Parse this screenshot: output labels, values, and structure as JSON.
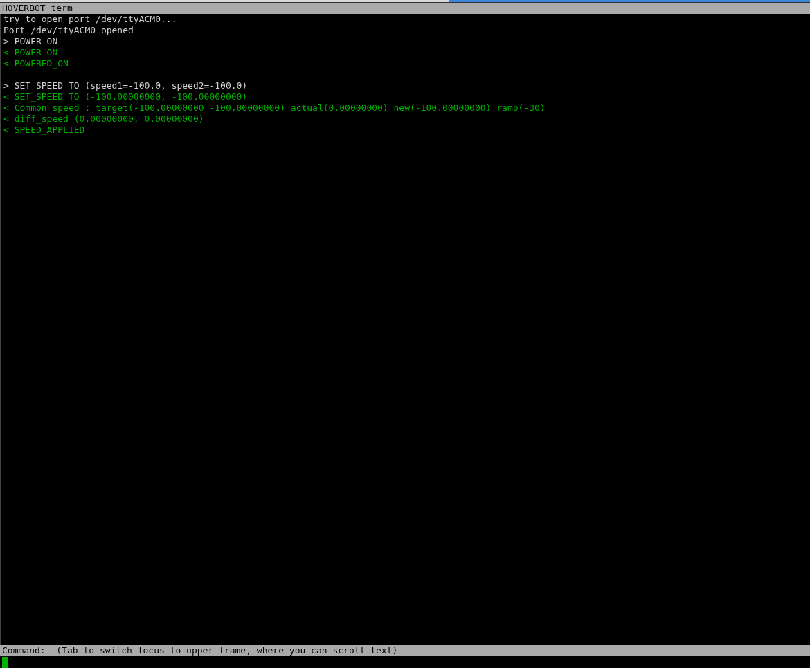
{
  "window": {
    "title": "HOVERBOT term"
  },
  "lines": [
    {
      "kind": "info",
      "text": "try to open port /dev/ttyACM0..."
    },
    {
      "kind": "info",
      "text": "Port /dev/ttyACM0 opened"
    },
    {
      "kind": "sent",
      "text": "> POWER_ON"
    },
    {
      "kind": "received",
      "text": "< POWER_ON"
    },
    {
      "kind": "received",
      "text": "< POWERED_ON"
    },
    {
      "kind": "blank"
    },
    {
      "kind": "sent",
      "text": "> SET SPEED TO (speed1=-100.0, speed2=-100.0)"
    },
    {
      "kind": "received",
      "text": "< SET_SPEED TO (-100.00000000, -100.00000000)"
    },
    {
      "kind": "received",
      "text": "< Common speed : target(-100.00000000 -100.00000000) actual(0.00000000) new(-100.00000000) ramp(-30)"
    },
    {
      "kind": "received",
      "text": "< diff_speed (0.00000000, 0.00000000)"
    },
    {
      "kind": "received",
      "text": "< SPEED_APPLIED"
    }
  ],
  "status_bar": {
    "text": "Command:  (Tab to switch focus to upper frame, where you can scroll text)"
  }
}
